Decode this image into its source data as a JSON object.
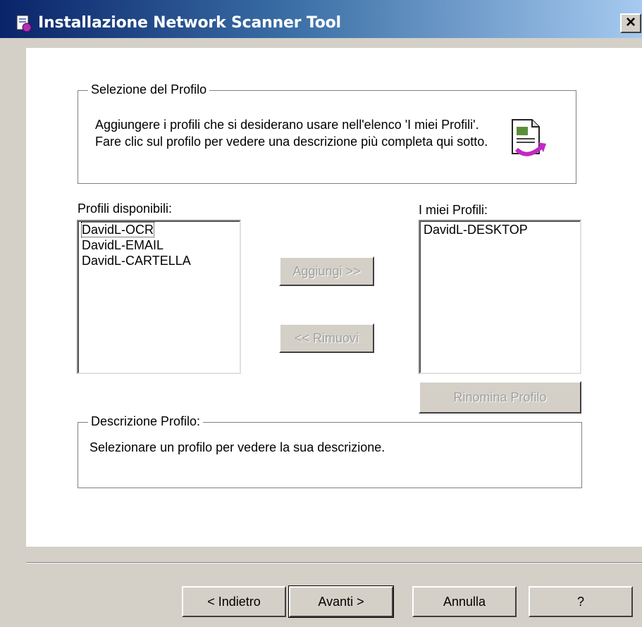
{
  "window": {
    "title": "Installazione Network Scanner Tool",
    "close_symbol": "×"
  },
  "profile_selection": {
    "legend": "Selezione del Profilo",
    "intro": "Aggiungere i profili che si desiderano usare nell'elenco 'I miei Profili'. Fare clic sul profilo per vedere una descrizione più completa qui sotto."
  },
  "available": {
    "label": "Profili disponibili:",
    "items": [
      "DavidL-OCR",
      "DavidL-EMAIL",
      "DavidL-CARTELLA"
    ]
  },
  "mine": {
    "label": "I miei Profili:",
    "items": [
      "DavidL-DESKTOP"
    ]
  },
  "buttons": {
    "add": "Aggiungi >>",
    "remove": "<< Rimuovi",
    "rename": "Rinomina Profilo"
  },
  "description": {
    "legend": "Descrizione Profilo:",
    "text": "Selezionare un profilo per vedere la sua descrizione."
  },
  "footer": {
    "back": "< Indietro",
    "next": "Avanti >",
    "cancel": "Annulla",
    "help": "?"
  },
  "colors": {
    "titlebar_start": "#0a246a",
    "titlebar_end": "#a6caf0",
    "dialog_bg": "#d4d0c8",
    "disabled_text": "#a0a0a0"
  },
  "icons": {
    "title": "installer-icon",
    "profile": "document-refresh-icon"
  }
}
